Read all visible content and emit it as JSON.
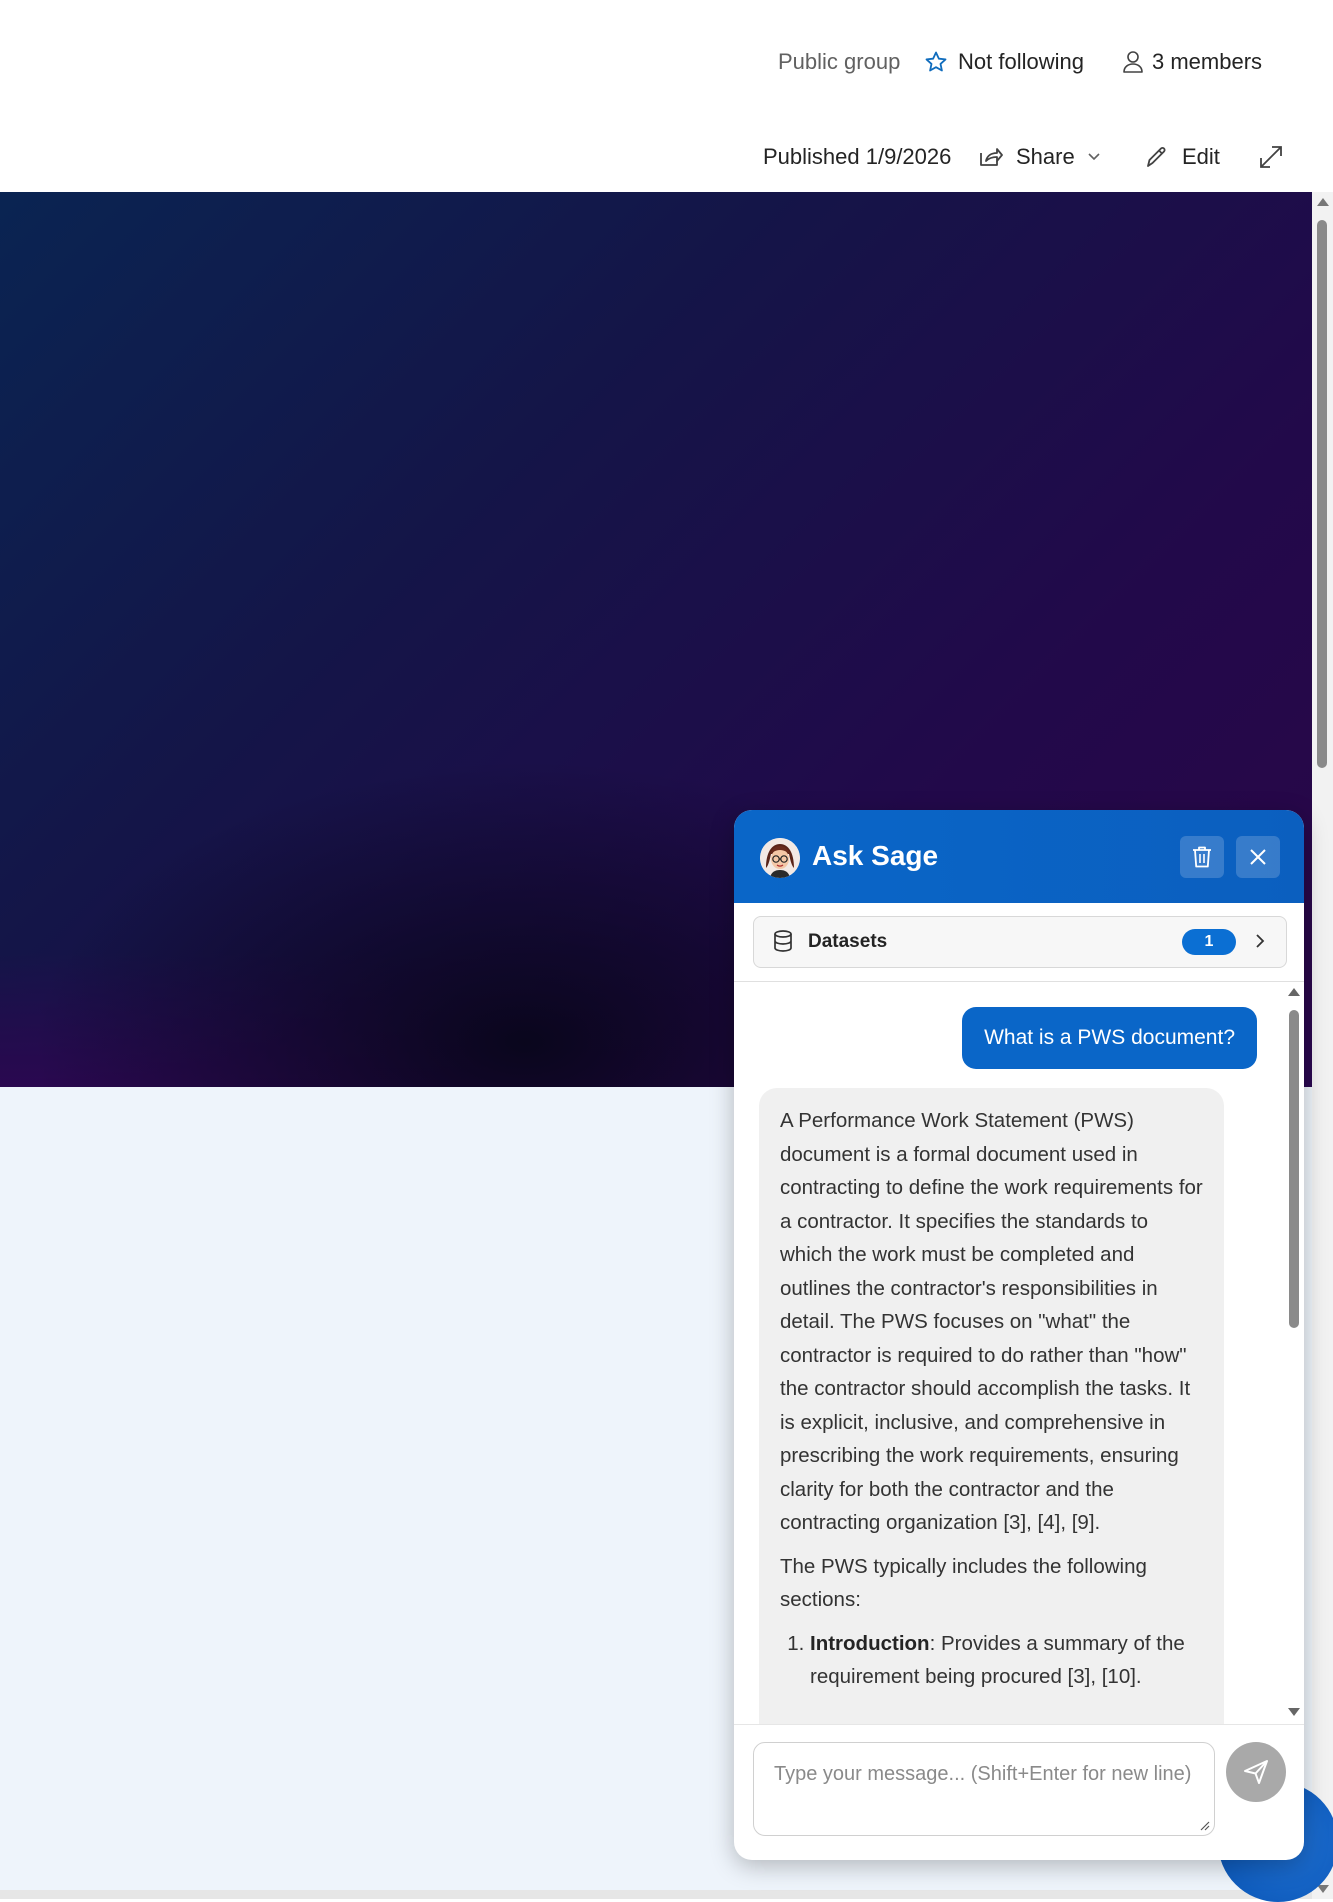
{
  "group_bar": {
    "privacy": "Public group",
    "follow_label": "Not following",
    "members_label": "3 members"
  },
  "command_bar": {
    "published": "Published 1/9/2026",
    "share_label": "Share",
    "edit_label": "Edit"
  },
  "chat": {
    "title": "Ask Sage",
    "datasets_label": "Datasets",
    "datasets_count": "1",
    "user_message": "What is a PWS document?",
    "bot_paragraph_1": "A Performance Work Statement (PWS) document is a formal document used in contracting to define the work requirements for a contractor. It specifies the standards to which the work must be completed and outlines the contractor's responsibilities in detail. The PWS focuses on \"what\" the contractor is required to do rather than \"how\" the contractor should accomplish the tasks. It is explicit, inclusive, and comprehensive in prescribing the work requirements, ensuring clarity for both the contractor and the contracting organization [3], [4], [9].",
    "bot_paragraph_2": "The PWS typically includes the following sections:",
    "bot_list": [
      {
        "term": "Introduction",
        "text": ": Provides a summary of the requirement being procured [3], [10]."
      }
    ],
    "input_placeholder": "Type your message... (Shift+Enter for new line)"
  },
  "colors": {
    "brand_blue": "#0a66c8",
    "hero_start": "#0a2452",
    "hero_end": "#2a0648"
  }
}
